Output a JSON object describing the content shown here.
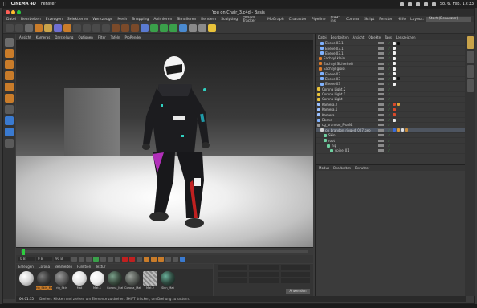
{
  "menubar": {
    "app": "CINEMA 4D",
    "items": [
      "Fenster"
    ],
    "clock": "So. 6. Feb. 17:33"
  },
  "window": {
    "title": "You on Chair_3.c4d - Basis"
  },
  "c4d_menu": [
    "Datei",
    "Bearbeiten",
    "Erzeugen",
    "Selektieren",
    "Werkzeuge",
    "Mesh",
    "Snapping",
    "Animieren",
    "Simulieren",
    "Rendern",
    "Sculpting",
    "Motion Tracker",
    "MoGraph",
    "Charakter",
    "Pipeline",
    "Plug-ins",
    "Corona",
    "Skript",
    "Fenster",
    "Hilfe"
  ],
  "layout": {
    "label": "Layout:",
    "value": "Start (Benutzer)"
  },
  "viewport_menu": [
    "Ansicht",
    "Kameras",
    "Darstellung",
    "Optionen",
    "Filter",
    "Tafeln",
    "ProRender"
  ],
  "object_manager": {
    "menu": [
      "Datei",
      "Bearbeiten",
      "Ansicht",
      "Objekte",
      "Tags",
      "Lesezeichen"
    ],
    "items": [
      {
        "name": "Ebene 03.1",
        "icon": "#7fb1ff",
        "tags": [
          "#f2f2f2",
          "#111111"
        ]
      },
      {
        "name": "Ebene 03.1",
        "icon": "#7fb1ff",
        "tags": [
          "#f2f2f2"
        ]
      },
      {
        "name": "Ebene 03.1",
        "icon": "#7fb1ff",
        "tags": [
          "#f2f2f2"
        ]
      },
      {
        "name": "Eachzyl klein",
        "icon": "#e07c2a",
        "tags": [
          "#f2f2f2"
        ]
      },
      {
        "name": "Eachzyl Sicherheit",
        "icon": "#e07c2a",
        "tags": [
          "#f2f2f2"
        ]
      },
      {
        "name": "Eachzyl gross",
        "icon": "#e07c2a",
        "tags": [
          "#f2f2f2"
        ]
      },
      {
        "name": "Ebene 03",
        "icon": "#7fb1ff",
        "tags": [
          "#f2f2f2"
        ]
      },
      {
        "name": "Ebene 03",
        "icon": "#7fb1ff",
        "tags": [
          "#f2f2f2",
          "#111111"
        ]
      },
      {
        "name": "Ebene 03",
        "icon": "#7fb1ff",
        "tags": [
          "#f2f2f2"
        ]
      },
      {
        "name": "Corona Light.2",
        "icon": "#e8c23a",
        "tags": []
      },
      {
        "name": "Corona Light.1",
        "icon": "#e8c23a",
        "tags": []
      },
      {
        "name": "Corona Light",
        "icon": "#e8c23a",
        "tags": []
      },
      {
        "name": "Kamera.2",
        "icon": "#9ac0ff",
        "tags": [
          "#d94a2b",
          "#e0a33b"
        ]
      },
      {
        "name": "Kamera.1",
        "icon": "#9ac0ff",
        "tags": [
          "#d94a2b"
        ]
      },
      {
        "name": "Kamera",
        "icon": "#9ac0ff",
        "tags": [
          "#d94a2b"
        ]
      },
      {
        "name": "Ebene",
        "icon": "#7fb1ff",
        "tags": [
          "#e8e8e8"
        ]
      },
      {
        "name": "cg_brandon_Plusf4",
        "icon": "#9a9a9a",
        "tags": []
      },
      {
        "name": "cg_brandon_rigged_007.geo",
        "icon": "#cfcfcf",
        "tags": [
          "#3a6bd8",
          "#e09b3a",
          "#e0e0e0",
          "#c98c3a"
        ]
      },
      {
        "name": "Skin",
        "icon": "#6fd0a0",
        "tags": []
      },
      {
        "name": "root",
        "icon": "#6fd0a0",
        "tags": []
      },
      {
        "name": "hip",
        "icon": "#6fd0a0",
        "tags": []
      },
      {
        "name": "spine_01",
        "icon": "#6fd0a0",
        "tags": []
      }
    ]
  },
  "attribute_manager": {
    "menu": [
      "Modus",
      "Bearbeiten",
      "Benutzer"
    ]
  },
  "timeline": {
    "current_frame": "0 B",
    "start": "0 B",
    "end": "90 B"
  },
  "material_manager": {
    "menu": [
      "Erzeugen",
      "Corona",
      "Bearbeiten",
      "Funktion",
      "Textur"
    ],
    "materials": [
      {
        "name": "",
        "color": "#d9d9d9"
      },
      {
        "name": "rig_Skin_Mat",
        "color": "#3b3b3b"
      },
      {
        "name": "rig_Skin",
        "color": "#5a5a5a"
      },
      {
        "name": "Mat",
        "color": "#e3e3e3"
      },
      {
        "name": "Mat.1",
        "color": "#eeeeee"
      },
      {
        "name": "Corona_Mat",
        "color": "#3a4b3f"
      },
      {
        "name": "Corona_Mat",
        "color": "#555a55"
      },
      {
        "name": "Mat.2",
        "color": "#bcbcbc"
      },
      {
        "name": "Skin_Mat",
        "color": "#2f4a40"
      }
    ]
  },
  "coordinates": {
    "apply_label": "Anwenden"
  },
  "status": {
    "time": "00:01:35",
    "text": "Drehen: Klicken und ziehen, um Elemente zu drehen. SHIFT drücken, um Drehung zu rastern."
  }
}
